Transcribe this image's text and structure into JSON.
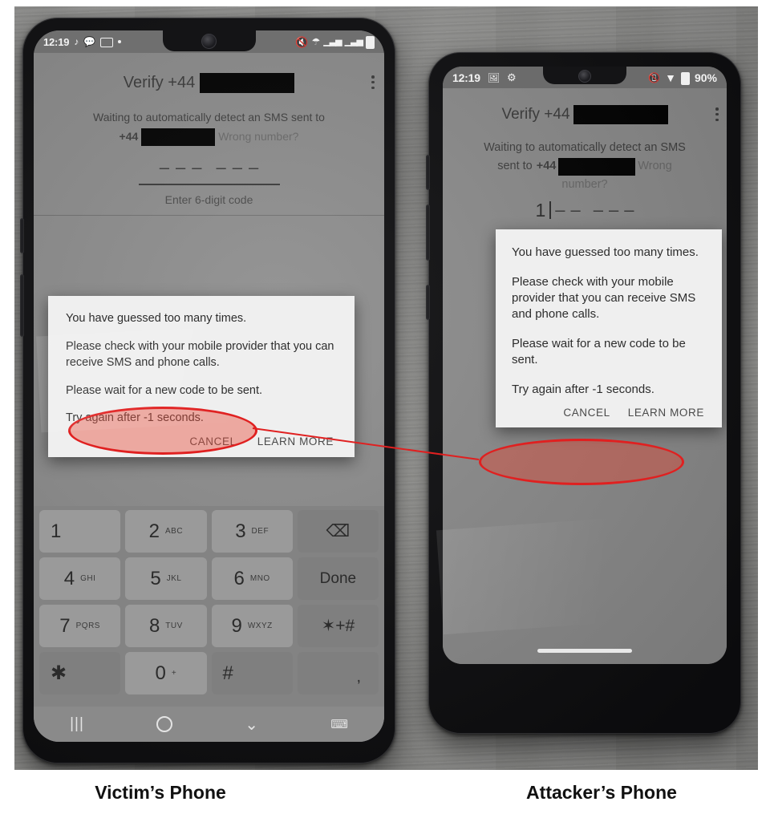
{
  "figure": {
    "captions": {
      "left": "Victim’s Phone",
      "right": "Attacker’s Phone"
    },
    "annotation_color": "#e02020",
    "annotation_fill": "#e8624a"
  },
  "victim_phone": {
    "status_bar": {
      "time": "12:19",
      "left_icons": [
        "music-note-icon",
        "message-bubble-icon",
        "voicemail-icon",
        "dot-icon"
      ],
      "right_icons": [
        "mute-icon",
        "wifi-icon",
        "signal-bars-icon",
        "signal-bars-icon",
        "battery-icon"
      ]
    },
    "app": {
      "title_prefix": "Verify +44",
      "title_redacted": true,
      "overflow_menu": "kebab-menu-icon",
      "waiting_text_line1": "Waiting to automatically detect an SMS sent to",
      "waiting_prefix": "+44",
      "waiting_redacted": true,
      "wrong_number_link": "Wrong number?",
      "code_entry_value": "",
      "code_dashes": [
        "–",
        "–",
        "–",
        "–",
        "–",
        "–"
      ],
      "code_hint": "Enter 6-digit code"
    },
    "dialog": {
      "line1": "You have guessed too many times.",
      "line2": "Please check with your mobile provider that you can receive SMS and phone calls.",
      "line3": "Please wait for a new code to be sent.",
      "line4": "Try again after -1 seconds.",
      "cancel": "CANCEL",
      "learn_more": "LEARN MORE"
    },
    "keypad": {
      "rows": [
        [
          {
            "digit": "1",
            "sub": ""
          },
          {
            "digit": "2",
            "sub": "ABC"
          },
          {
            "digit": "3",
            "sub": "DEF"
          },
          {
            "word": "⌫",
            "type": "backspace"
          }
        ],
        [
          {
            "digit": "4",
            "sub": "GHI"
          },
          {
            "digit": "5",
            "sub": "JKL"
          },
          {
            "digit": "6",
            "sub": "MNO"
          },
          {
            "word": "Done",
            "type": "action"
          }
        ],
        [
          {
            "digit": "7",
            "sub": "PQRS"
          },
          {
            "digit": "8",
            "sub": "TUV"
          },
          {
            "digit": "9",
            "sub": "WXYZ"
          },
          {
            "word": "✶+#",
            "type": "symbols"
          }
        ],
        [
          {
            "digit": "✱",
            "sub": ""
          },
          {
            "digit": "0",
            "sub": "+"
          },
          {
            "digit": "#",
            "sub": ""
          },
          {
            "word": ",",
            "type": "comma"
          }
        ]
      ]
    },
    "nav_bar": {
      "recents": "|||",
      "home": "home-circle-icon",
      "back": "chevron-down-icon",
      "keyboard": "keyboard-icon"
    }
  },
  "attacker_phone": {
    "status_bar": {
      "time": "12:19",
      "left_icons": [
        "photo-icon",
        "gear-icon"
      ],
      "right_icons": [
        "vibrate-icon",
        "wifi-icon",
        "battery-icon"
      ],
      "battery_percent": "90%"
    },
    "app": {
      "title_prefix": "Verify +44",
      "title_redacted": true,
      "overflow_menu": "kebab-menu-icon",
      "waiting_text_line1": "Waiting to automatically detect an SMS",
      "waiting_text_line2_prefix": "sent to",
      "waiting_prefix": "+44",
      "waiting_redacted": true,
      "wrong_number_link": "Wrong number?",
      "code_entry_value": "1",
      "code_hint": ""
    },
    "dialog": {
      "line1": "You have guessed too many times.",
      "line2": "Please check with your mobile provider that you can receive SMS and phone calls.",
      "line3": "Please wait for a new code to be sent.",
      "line4": "Try again after -1 seconds.",
      "cancel": "CANCEL",
      "learn_more": "LEARN MORE"
    },
    "nav_bar": {
      "gesture_pill": "gesture-pill-indicator"
    }
  }
}
